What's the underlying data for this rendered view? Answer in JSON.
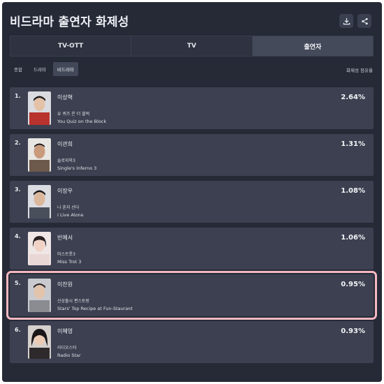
{
  "header": {
    "title": "비드라마 출연자 화제성",
    "download_icon": "download-icon",
    "share_icon": "share-icon"
  },
  "tabs": [
    {
      "label": "TV-OTT",
      "active": false
    },
    {
      "label": "TV",
      "active": false
    },
    {
      "label": "출연자",
      "active": true
    }
  ],
  "subtabs": [
    {
      "label": "종합",
      "active": false
    },
    {
      "label": "드라마",
      "active": false
    },
    {
      "label": "비드라마",
      "active": true
    }
  ],
  "sort_label": "화제성 점유율",
  "ranking": [
    {
      "rank": "1.",
      "name": "이상혁",
      "show_ko": "유 퀴즈 온 더 블럭",
      "show_en": "You Quiz on the Block",
      "share": "2.64%",
      "avatar_color": "#b8322e",
      "highlight": false
    },
    {
      "rank": "2.",
      "name": "이관희",
      "show_ko": "솔로지옥3",
      "show_en": "Single's Inferno 3",
      "share": "1.31%",
      "avatar_color": "#6d5a4c",
      "highlight": false
    },
    {
      "rank": "3.",
      "name": "이장우",
      "show_ko": "나 혼자 산다",
      "show_en": "I Live Alone",
      "share": "1.08%",
      "avatar_color": "#4a4f5c",
      "highlight": false
    },
    {
      "rank": "4.",
      "name": "빈예서",
      "show_ko": "미스트롯3",
      "show_en": "Miss Trot 3",
      "share": "1.06%",
      "avatar_color": "#e9d7d6",
      "highlight": false
    },
    {
      "rank": "5.",
      "name": "이찬원",
      "show_ko": "신상출시 편스토랑",
      "show_en": "Stars' Top Recipe at Fun-Staurant",
      "share": "0.95%",
      "avatar_color": "#8a8c92",
      "highlight": true
    },
    {
      "rank": "6.",
      "name": "이혜영",
      "show_ko": "라디오스타",
      "show_en": "Radio Star",
      "share": "0.93%",
      "avatar_color": "#2e2a2c",
      "highlight": false
    }
  ]
}
